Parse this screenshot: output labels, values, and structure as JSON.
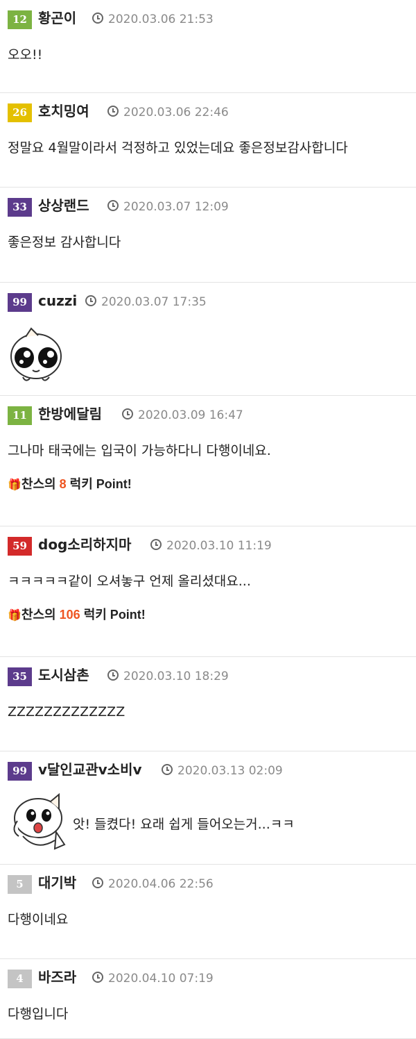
{
  "colors": {
    "purple": "#5c3b8c",
    "green": "#7cb342",
    "yellow": "#e4c000",
    "red": "#d32a2a",
    "gray": "#c4c4c4",
    "points": "#ee5522"
  },
  "lucky_text": {
    "prefix": "찬스의",
    "suffix": "럭키 Point!"
  },
  "comments": [
    {
      "level": "12",
      "level_color": "green",
      "nickname": "황곤이",
      "date": "2020.03.06 21:53",
      "text": "오오!!"
    },
    {
      "level": "26",
      "level_color": "yellow",
      "nickname": "호치밍여",
      "date": "2020.03.06 22:46",
      "text": "정말요   4월말이라서 걱정하고 있었는데요 좋은정보감사합니다"
    },
    {
      "level": "33",
      "level_color": "purple",
      "nickname": "상상랜드",
      "date": "2020.03.07 12:09",
      "text": "좋은정보 감사합니다"
    },
    {
      "level": "99",
      "level_color": "purple",
      "nickname": "cuzzi",
      "date": "2020.03.07 17:35",
      "emoticon": "teary-eyes-face"
    },
    {
      "level": "11",
      "level_color": "green",
      "nickname": "한방에달림",
      "date": "2020.03.09 16:47",
      "text": "그나마 태국에는 입국이 가능하다니 다행이네요.",
      "lucky": "8"
    },
    {
      "level": "59",
      "level_color": "red",
      "nickname": "dog소리하지마",
      "date": "2020.03.10 11:19",
      "text": "ㅋㅋㅋㅋㅋ같이 오셔놓구 언제 올리셨대요...",
      "lucky": "106"
    },
    {
      "level": "35",
      "level_color": "purple",
      "nickname": "도시삼촌",
      "date": "2020.03.10 18:29",
      "text": "ZZZZZZZZZZZZZ"
    },
    {
      "level": "99",
      "level_color": "purple",
      "nickname": "v달인교관v소비v",
      "date": "2020.03.13 02:09",
      "emoticon": "surprised-face",
      "text": "앗! 들켰다!   요래 쉽게 들어오는거...ㅋㅋ"
    },
    {
      "level": "5",
      "level_color": "gray",
      "nickname": "대기박",
      "date": "2020.04.06 22:56",
      "text": "다행이네요"
    },
    {
      "level": "4",
      "level_color": "gray",
      "nickname": "바즈라",
      "date": "2020.04.10 07:19",
      "text": "다행입니다"
    }
  ]
}
